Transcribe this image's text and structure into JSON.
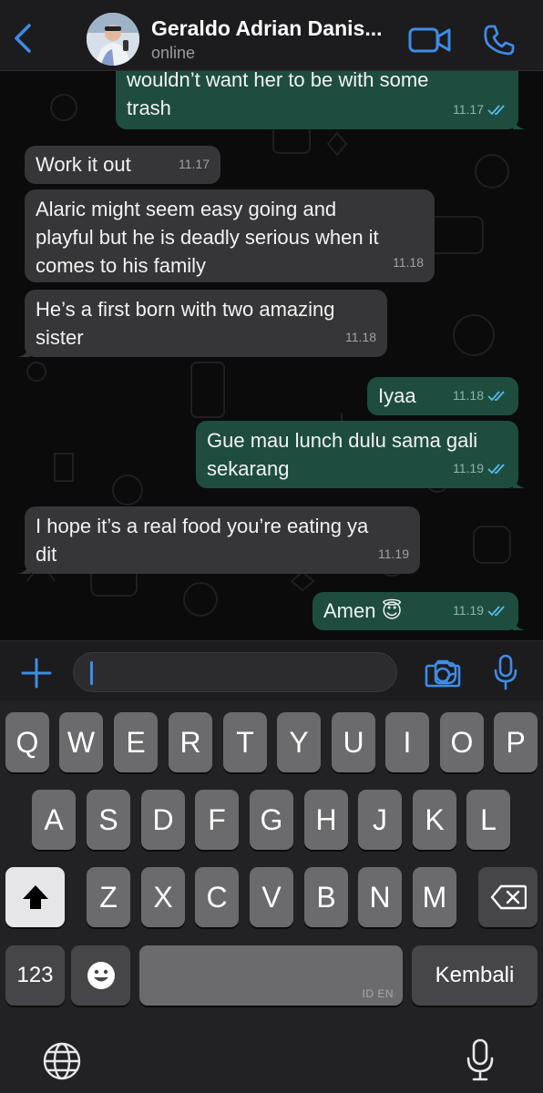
{
  "header": {
    "contact_name": "Geraldo Adrian Danis...",
    "status": "online"
  },
  "messages": [
    {
      "direction": "out",
      "text": "wouldn’t want her to be with some\ntrash",
      "time": "11.17",
      "read": true
    },
    {
      "direction": "in",
      "text": "Work it out",
      "time": "11.17"
    },
    {
      "direction": "in",
      "text": "Alaric might seem easy going and\nplayful but he is deadly serious when it\ncomes to his family",
      "time": "11.18"
    },
    {
      "direction": "in",
      "text": "He’s a first born with two amazing\nsister",
      "time": "11.18"
    },
    {
      "direction": "out",
      "text": "Iyaa",
      "time": "11.18",
      "read": true
    },
    {
      "direction": "out",
      "text": "Gue mau lunch dulu sama gali\nsekarang",
      "time": "11.19",
      "read": true
    },
    {
      "direction": "in",
      "text": "I hope it’s a real food you’re eating ya\ndit",
      "time": "11.19"
    },
    {
      "direction": "out",
      "text": "Amen 😇",
      "time": "11.19",
      "read": true
    }
  ],
  "input": {
    "value": ""
  },
  "keyboard": {
    "row1": [
      "Q",
      "W",
      "E",
      "R",
      "T",
      "Y",
      "U",
      "I",
      "O",
      "P"
    ],
    "row2": [
      "A",
      "S",
      "D",
      "F",
      "G",
      "H",
      "J",
      "K",
      "L"
    ],
    "row3": [
      "Z",
      "X",
      "C",
      "V",
      "B",
      "N",
      "M"
    ],
    "numbers_label": "123",
    "space_lang": "ID EN",
    "return_label": "Kembali"
  },
  "colors": {
    "accent": "#3e8ce6",
    "incoming_bubble": "#363638",
    "outgoing_bubble": "#1e4d40",
    "read_ticks": "#53bdeb"
  }
}
